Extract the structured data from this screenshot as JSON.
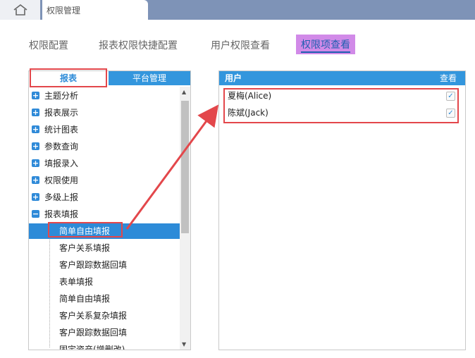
{
  "window": {
    "tab_title": "权限管理"
  },
  "subtabs": [
    "权限配置",
    "报表权限快捷配置",
    "用户权限查看",
    "权限项查看"
  ],
  "left": {
    "tabs": [
      "报表",
      "平台管理"
    ],
    "tree": [
      {
        "label": "主题分析",
        "toggle": "+"
      },
      {
        "label": "报表展示",
        "toggle": "+"
      },
      {
        "label": "统计图表",
        "toggle": "+"
      },
      {
        "label": "参数查询",
        "toggle": "+"
      },
      {
        "label": "填报录入",
        "toggle": "+"
      },
      {
        "label": "权限使用",
        "toggle": "+"
      },
      {
        "label": "多级上报",
        "toggle": "+"
      },
      {
        "label": "报表填报",
        "toggle": "−"
      },
      {
        "label": "简单自由填报"
      },
      {
        "label": "客户关系填报"
      },
      {
        "label": "客户跟踪数据回填"
      },
      {
        "label": "表单填报"
      },
      {
        "label": "简单自由填报"
      },
      {
        "label": "客户关系复杂填报"
      },
      {
        "label": "客户跟踪数据回填"
      },
      {
        "label": "固定资产(增删改)"
      }
    ]
  },
  "right": {
    "header": {
      "user": "用户",
      "view": "查看"
    },
    "users": [
      "夏梅(Alice)",
      "陈斌(Jack)"
    ],
    "check": "✓"
  }
}
